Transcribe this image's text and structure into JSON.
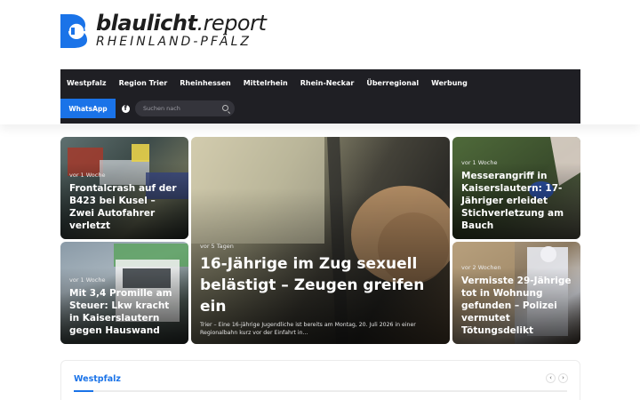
{
  "logo": {
    "main_bold": "blaulicht",
    "main_rest": ".report",
    "sub": "RHEINLAND-PFÄLZ"
  },
  "nav": {
    "items": [
      "Westpfalz",
      "Region Trier",
      "Rheinhessen",
      "Mittelrhein",
      "Rhein-Neckar",
      "Überregional",
      "Werbung"
    ],
    "whatsapp_label": "WhatsApp",
    "search_placeholder": "Suchen nach"
  },
  "featured": {
    "c1": {
      "meta": "vor 1 Woche",
      "title": "Frontalcrash auf der B423 bei Kusel – Zwei Autofahrer verletzt"
    },
    "c2": {
      "meta": "vor 1 Woche",
      "title": "Mit 3,4 Promille am Steuer: Lkw kracht in Kaiserslautern gegen Hauswand"
    },
    "c3": {
      "meta": "vor 5 Tagen",
      "title": "16-Jährige im Zug sexuell belästigt – Zeugen greifen ein",
      "excerpt": "Trier – Eine 16-jährige Jugendliche ist bereits am Montag, 20. Juli 2026 in einer Regionalbahn kurz vor der Einfahrt in..."
    },
    "c4": {
      "meta": "vor 1 Woche",
      "title": "Messerangriff in Kaiserslautern: 17-Jähriger erleidet Stichverletzung am Bauch"
    },
    "c5": {
      "meta": "vor 2 Wochen",
      "title": "Vermisste 29-Jährige tot in Wohnung gefunden – Polizei vermutet Tötungsdelikt"
    }
  },
  "section": {
    "title": "Westpfalz",
    "prev": "‹",
    "next": "›"
  },
  "colors": {
    "accent": "#1a73e8",
    "nav_bg": "#1f1f24"
  }
}
